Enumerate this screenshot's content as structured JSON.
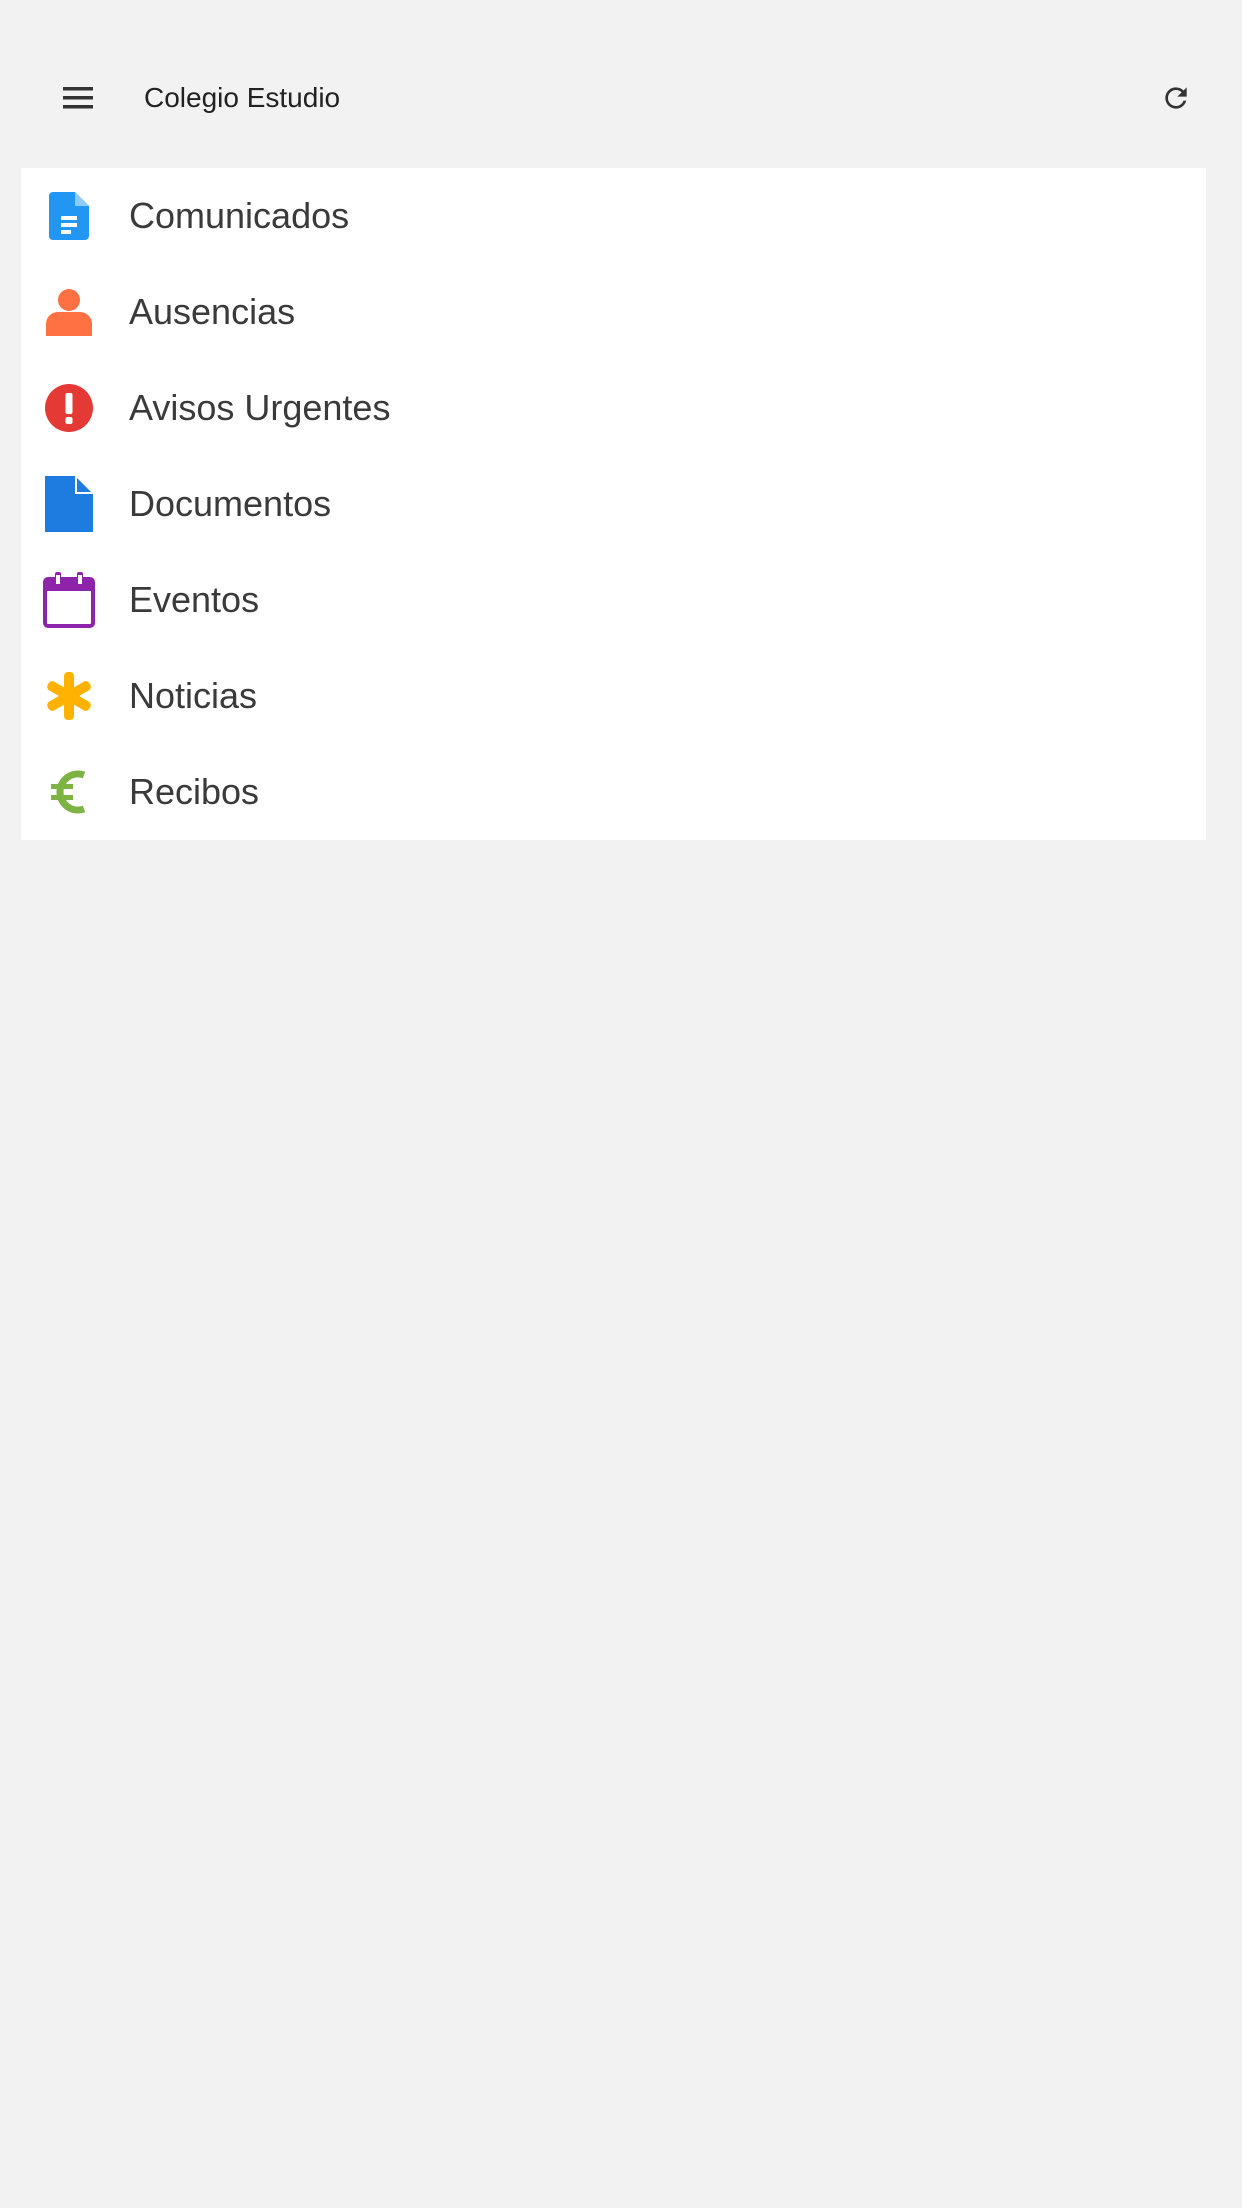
{
  "header": {
    "title": "Colegio Estudio",
    "menu_icon": "hamburger-menu-icon",
    "refresh_icon": "refresh-icon"
  },
  "menu": {
    "items": [
      {
        "label": "Comunicados",
        "icon": "document-text-icon",
        "color": "#2196f3"
      },
      {
        "label": "Ausencias",
        "icon": "person-icon",
        "color": "#ff7043"
      },
      {
        "label": "Avisos Urgentes",
        "icon": "alert-circle-icon",
        "color": "#e53935"
      },
      {
        "label": "Documentos",
        "icon": "file-icon",
        "color": "#1e7be0"
      },
      {
        "label": "Eventos",
        "icon": "calendar-icon",
        "color": "#8e24aa"
      },
      {
        "label": "Noticias",
        "icon": "asterisk-icon",
        "color": "#ffb300"
      },
      {
        "label": "Recibos",
        "icon": "euro-icon",
        "color": "#7cb342"
      }
    ]
  },
  "colors": {
    "background": "#f2f2f2",
    "card": "#ffffff",
    "text": "#3a3a3a"
  }
}
